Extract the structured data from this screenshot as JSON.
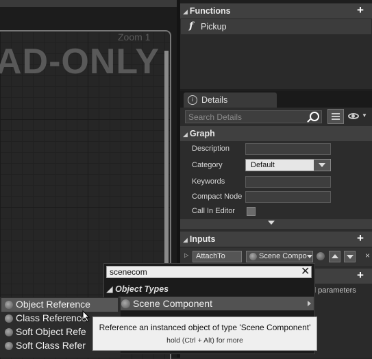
{
  "graph": {
    "zoom_label": "Zoom 1",
    "watermark": "AD-ONLY"
  },
  "functions": {
    "header": "Functions",
    "items": [
      {
        "icon": "function-icon",
        "glyph": "f",
        "label": "Pickup"
      }
    ]
  },
  "details": {
    "tab_label": "Details",
    "search_placeholder": "Search Details",
    "graph_section": {
      "header": "Graph",
      "props": {
        "description": "Description",
        "category": "Category",
        "category_value": "Default",
        "keywords": "Keywords",
        "compact_node": "Compact Node",
        "call_in_editor": "Call In Editor"
      }
    },
    "inputs_section": {
      "header": "Inputs",
      "param_name": "AttachTo",
      "param_type": "Scene Compo",
      "remove_glyph": "×"
    },
    "outputs_section": {
      "partial_text": "d parameters"
    }
  },
  "type_picker": {
    "search_value": "scenecom",
    "clear_glyph": "✕",
    "category_header": "Object Types",
    "result": "Scene Component",
    "submenu": [
      "Object Reference",
      "Class Reference",
      "Soft Object Refe",
      "Soft Class Refer"
    ]
  },
  "tooltip": {
    "text": "Reference an instanced object of type 'Scene Component'",
    "hint": "hold (Ctrl + Alt) for more"
  },
  "colors": {
    "panel_bg": "#2c2c2c",
    "header_bg": "#404040",
    "highlight": "#575757",
    "tooltip_bg": "#efefef"
  }
}
